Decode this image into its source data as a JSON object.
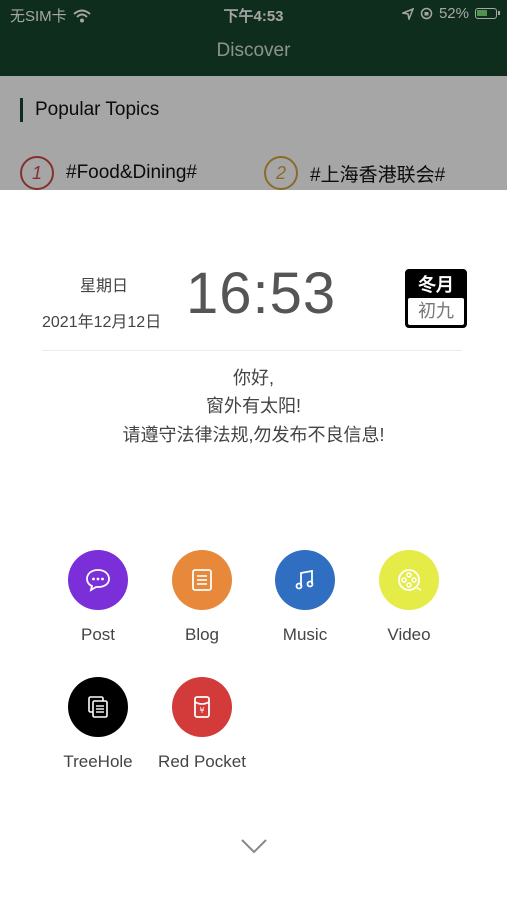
{
  "status_bar": {
    "carrier": "无SIM卡",
    "time": "下午4:53",
    "battery": "52%"
  },
  "nav": {
    "title": "Discover"
  },
  "popular": {
    "title": "Popular Topics",
    "topics": [
      {
        "rank": "1",
        "label": "#Food&Dining#"
      },
      {
        "rank": "2",
        "label": "#上海香港联会#"
      }
    ]
  },
  "sheet": {
    "weekday": "星期日",
    "date": "2021年12月12日",
    "clock": "16:53",
    "lunar_month": "冬月",
    "lunar_day": "初九",
    "greeting": [
      "你好,",
      "窗外有太阳!",
      "请遵守法律法规,勿发布不良信息!"
    ],
    "actions": [
      {
        "label": "Post",
        "icon": "chat-bubble-icon",
        "color": "#7b2fd8"
      },
      {
        "label": "Blog",
        "icon": "document-icon",
        "color": "#e8883a"
      },
      {
        "label": "Music",
        "icon": "music-note-icon",
        "color": "#2f6ec0"
      },
      {
        "label": "Video",
        "icon": "film-reel-icon",
        "color": "#e6ec47"
      },
      {
        "label": "TreeHole",
        "icon": "stacked-cards-icon",
        "color": "#000000"
      },
      {
        "label": "Red Pocket",
        "icon": "red-envelope-icon",
        "color": "#d33a3a"
      }
    ]
  }
}
